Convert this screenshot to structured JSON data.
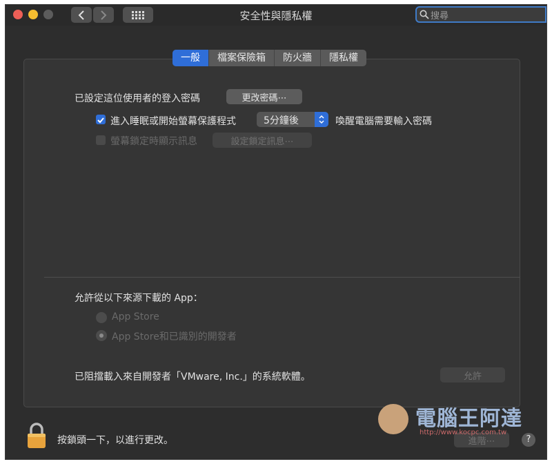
{
  "window": {
    "title": "安全性與隱私權"
  },
  "toolbar": {
    "back_icon": "chevron-left-icon",
    "forward_icon": "chevron-right-icon",
    "grid_icon": "grid-icon"
  },
  "search": {
    "placeholder": "搜尋"
  },
  "tabs": [
    {
      "label": "一般",
      "active": true
    },
    {
      "label": "檔案保險箱",
      "active": false
    },
    {
      "label": "防火牆",
      "active": false
    },
    {
      "label": "隱私權",
      "active": false
    }
  ],
  "general": {
    "password_label": "已設定這位使用者的登入密碼",
    "change_password_button": "更改密碼⋯",
    "require_password": {
      "label": "進入睡眠或開始螢幕保護程式",
      "checked": true,
      "delay_value": "5分鐘後",
      "suffix": "喚醒電腦需要輸入密碼"
    },
    "show_message": {
      "label": "螢幕鎖定時顯示訊息",
      "checked": false,
      "button": "設定鎖定訊息⋯"
    }
  },
  "downloads": {
    "heading": "允許從以下來源下載的 App：",
    "options": [
      {
        "label": "App Store",
        "selected": false
      },
      {
        "label": "App Store和已識別的開發者",
        "selected": true
      }
    ]
  },
  "blocked": {
    "text": "已阻擋載入來自開發者「VMware, Inc.」的系統軟體。",
    "allow_button": "允許"
  },
  "footer": {
    "lock_text": "按鎖頭一下，以進行更改。",
    "advanced_button": "進階⋯",
    "help_label": "?"
  },
  "watermark": {
    "title": "電腦王阿達",
    "url": "http://www.kocpc.com.tw"
  },
  "colors": {
    "accent": "#2f6ed8",
    "window_bg": "#2d2d2d",
    "panel_bg": "#353535"
  }
}
